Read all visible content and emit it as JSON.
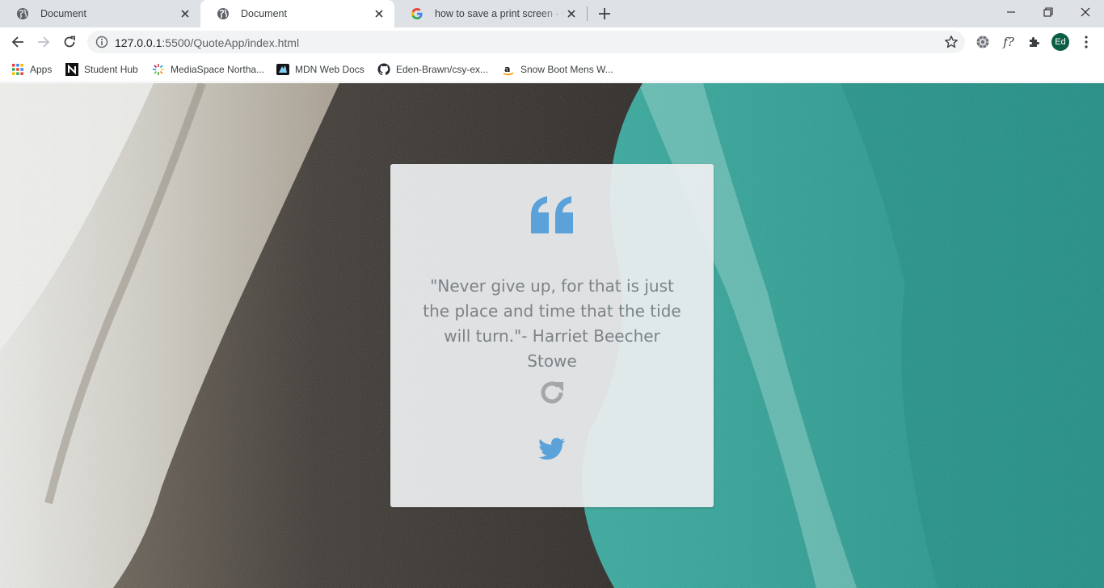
{
  "tabs": [
    {
      "title": "Document",
      "active": false
    },
    {
      "title": "Document",
      "active": true
    },
    {
      "title": "how to save a print screen - Google Search",
      "active": false
    }
  ],
  "address_bar": {
    "host": "127.0.0.1",
    "path": ":5500/QuoteApp/index.html"
  },
  "profile": {
    "initials": "Ed",
    "color": "#0b5d45"
  },
  "extension_fx_label": "f?",
  "bookmarks": [
    {
      "label": "Apps",
      "icon": "apps-grid-icon"
    },
    {
      "label": "Student Hub",
      "icon": "student-hub-icon"
    },
    {
      "label": "MediaSpace Northa...",
      "icon": "mediaspace-icon"
    },
    {
      "label": "MDN Web Docs",
      "icon": "mdn-icon"
    },
    {
      "label": "Eden-Brawn/csy-ex...",
      "icon": "github-icon"
    },
    {
      "label": "Snow Boot Mens W...",
      "icon": "amazon-icon"
    }
  ],
  "quote_card": {
    "quote": "\"Never give up, for that is just the place and time that the tide will turn.\"- Harriet Beecher Stowe",
    "accent_color": "#5aa2d9",
    "text_color": "#7b8387"
  }
}
